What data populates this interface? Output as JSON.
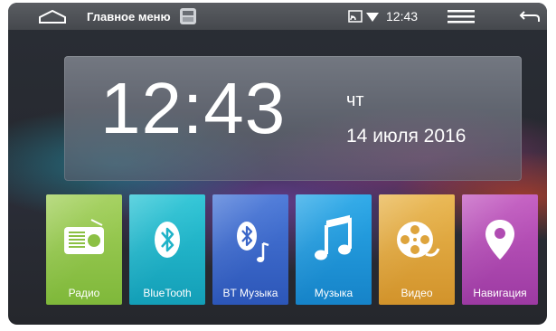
{
  "status_bar": {
    "title": "Главное меню",
    "time": "12:43",
    "icons": [
      "home-icon",
      "sd-card-icon",
      "cast-icon",
      "wifi-icon",
      "menu-icon",
      "back-icon"
    ]
  },
  "clock": {
    "time": "12:43",
    "weekday": "чт",
    "date": "14 июля 2016"
  },
  "apps": [
    {
      "label": "Радио",
      "icon": "radio-icon",
      "color": "#8cc044"
    },
    {
      "label": "BlueTooth",
      "icon": "bluetooth-icon",
      "color": "#1fb3c8"
    },
    {
      "label": "BT Музыка",
      "icon": "bluetooth-music-icon",
      "color": "#3a66c8"
    },
    {
      "label": "Музыка",
      "icon": "music-note-icon",
      "color": "#1f97d8"
    },
    {
      "label": "Видео",
      "icon": "film-reel-icon",
      "color": "#dea43c"
    },
    {
      "label": "Навигация",
      "icon": "location-pin-icon",
      "color": "#b04cb2"
    }
  ]
}
